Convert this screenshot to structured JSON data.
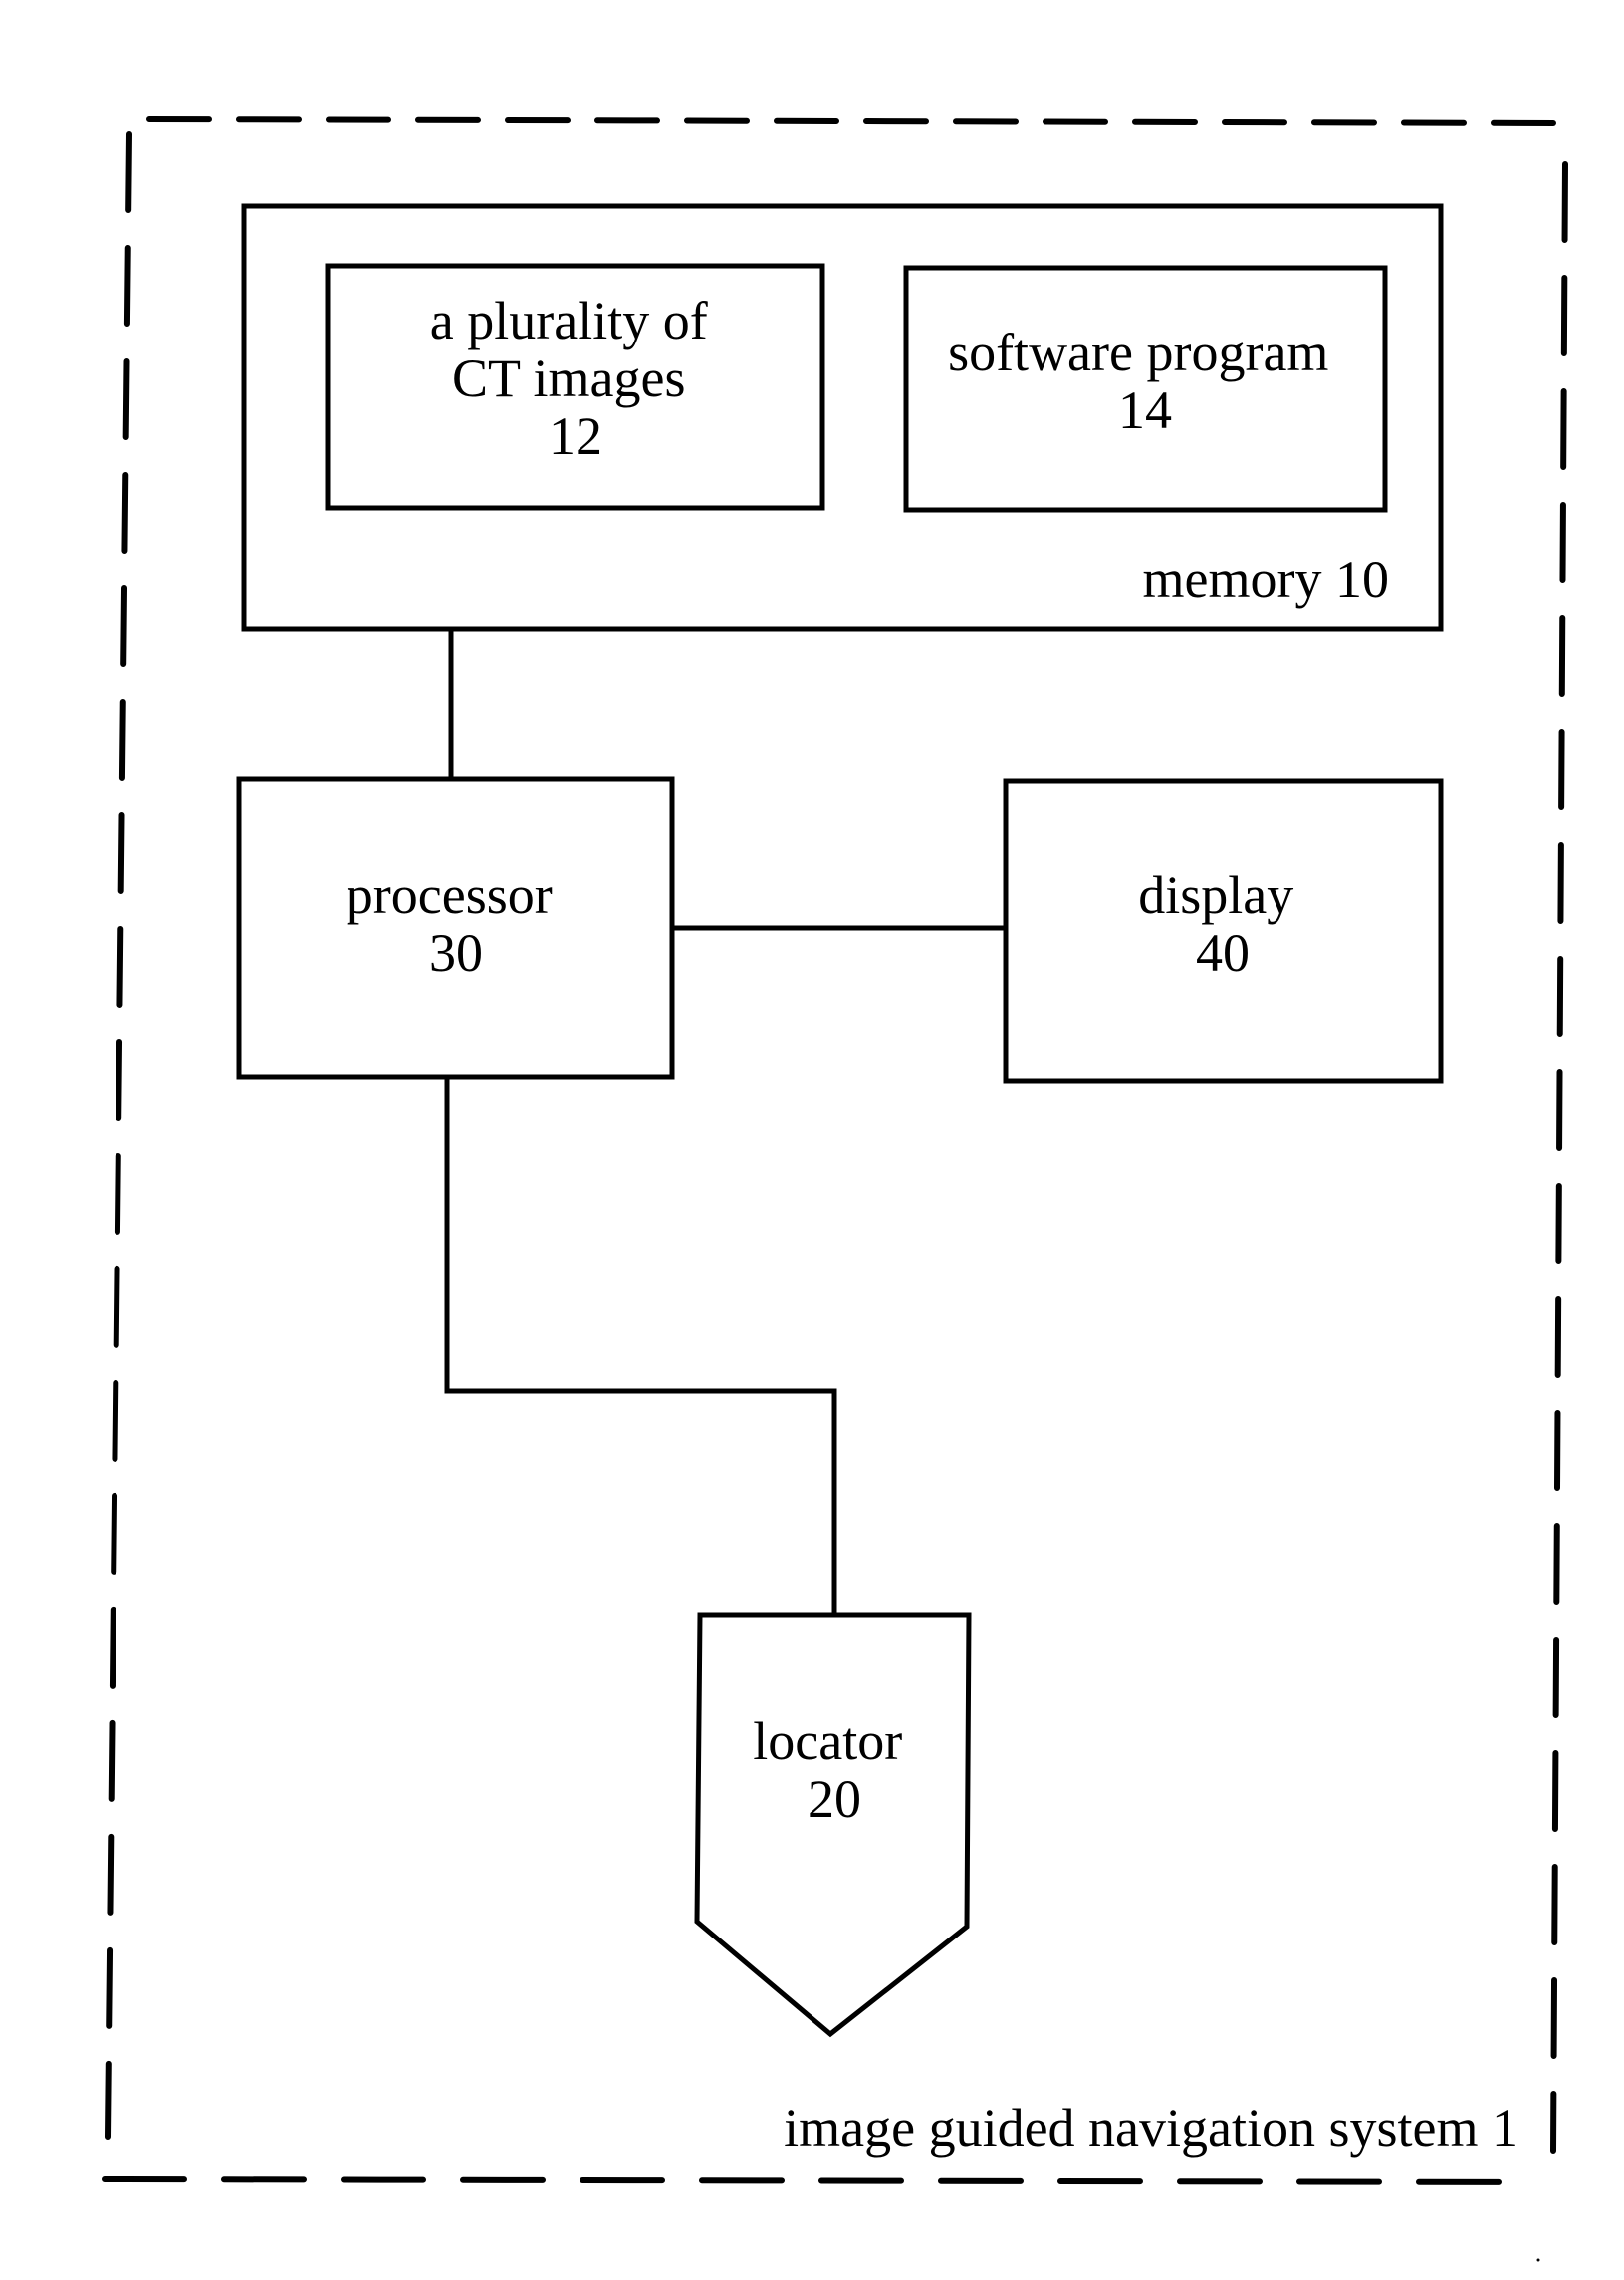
{
  "figure": {
    "type": "block-diagram",
    "system": {
      "label": "image guided navigation system 1"
    },
    "memory": {
      "label": "memory 10"
    },
    "ct_images": {
      "lines": [
        "a plurality of",
        "CT images",
        "12"
      ]
    },
    "software": {
      "lines": [
        "software program",
        "14"
      ]
    },
    "processor": {
      "lines": [
        "processor",
        "30"
      ]
    },
    "display": {
      "lines": [
        "display",
        "40"
      ]
    },
    "locator": {
      "lines": [
        "locator",
        "20"
      ]
    },
    "connections": [
      {
        "from": "memory 10",
        "to": "processor 30"
      },
      {
        "from": "processor 30",
        "to": "display 40"
      },
      {
        "from": "processor 30",
        "to": "locator 20"
      }
    ],
    "colors": {
      "stroke": "#000000",
      "background": "#ffffff"
    }
  }
}
